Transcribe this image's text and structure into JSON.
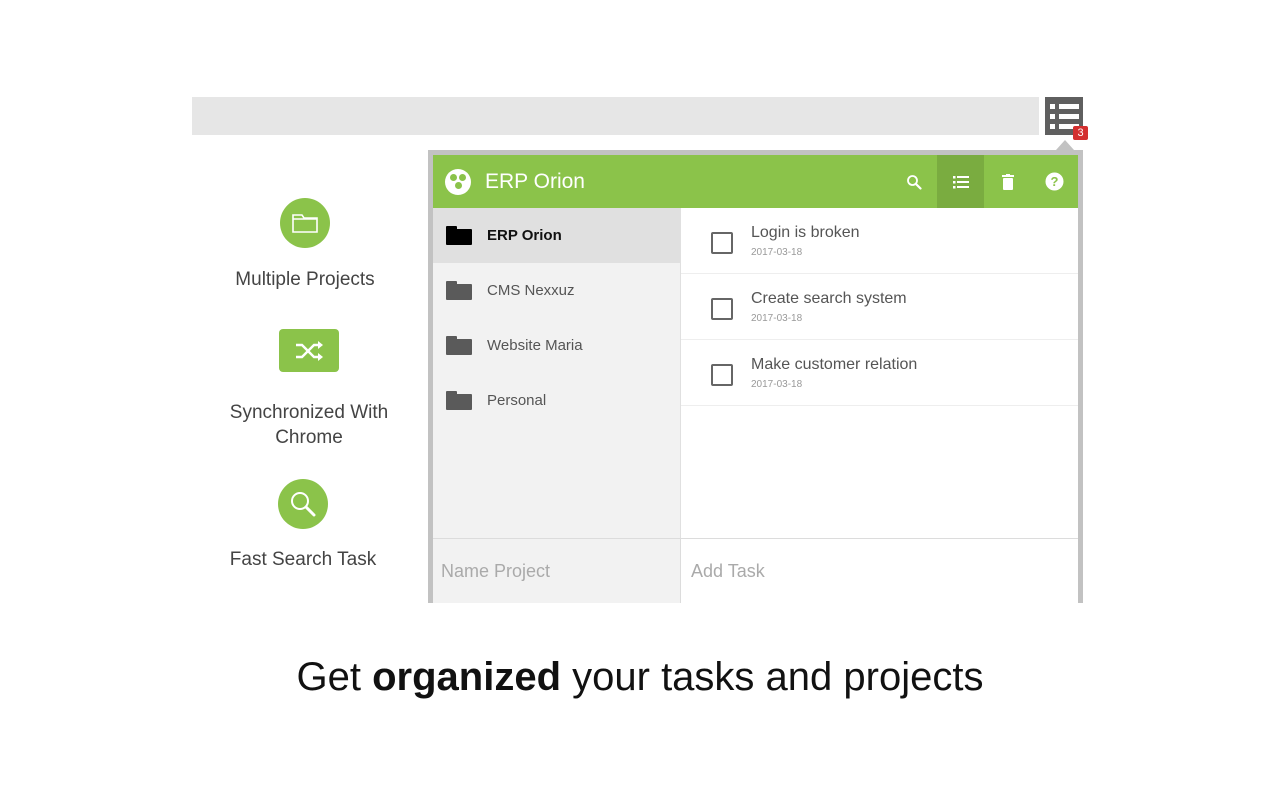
{
  "extension": {
    "icon": "list-icon",
    "badge": "3"
  },
  "features": [
    {
      "icon": "folder-icon",
      "label": "Multiple Projects"
    },
    {
      "icon": "shuffle-icon",
      "label": "Synchronized With Chrome"
    },
    {
      "icon": "search-icon",
      "label": "Fast Search Task"
    }
  ],
  "popup": {
    "title": "ERP Orion",
    "logo": "orion-logo-icon",
    "actions": [
      "search-icon",
      "list-icon",
      "trash-icon",
      "help-icon"
    ],
    "accent": "#8bc34a",
    "projects": [
      {
        "name": "ERP Orion",
        "selected": true
      },
      {
        "name": "CMS Nexxuz",
        "selected": false
      },
      {
        "name": "Website Maria",
        "selected": false
      },
      {
        "name": "Personal",
        "selected": false
      }
    ],
    "tasks": [
      {
        "title": "Login is broken",
        "date": "2017-03-18",
        "done": false
      },
      {
        "title": "Create search system",
        "date": "2017-03-18",
        "done": false
      },
      {
        "title": "Make customer relation",
        "date": "2017-03-18",
        "done": false
      }
    ],
    "name_project_placeholder": "Name Project",
    "add_task_placeholder": "Add Task"
  },
  "tagline": {
    "before": "Get ",
    "bold": "organized",
    "after": " your tasks and projects"
  }
}
